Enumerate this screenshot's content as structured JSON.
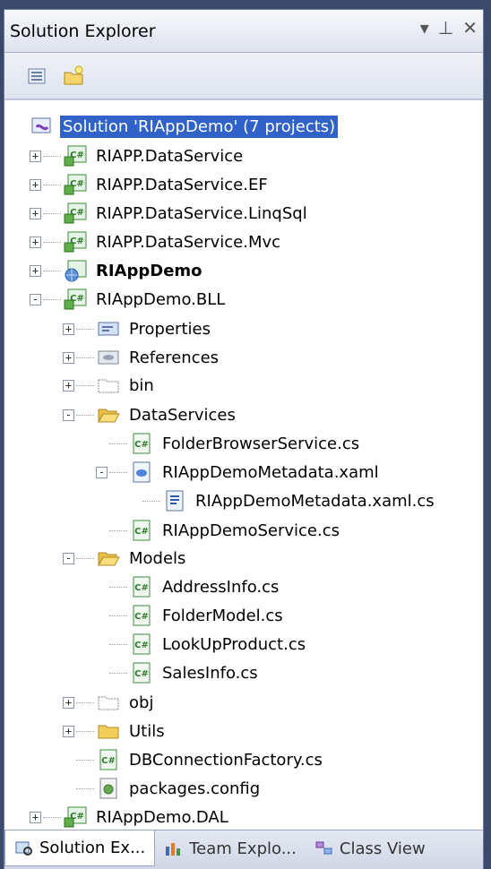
{
  "panel": {
    "title": "Solution Explorer",
    "dropdown_icon": "chevron-down-icon",
    "pin_icon": "pin-icon",
    "close_icon": "close-icon"
  },
  "toolbar": {
    "buttons": [
      {
        "name": "properties-button",
        "icon": "properties-icon"
      },
      {
        "name": "new-folder-button",
        "icon": "new-folder-icon"
      }
    ]
  },
  "tree": {
    "nodes": [
      {
        "label": "Solution 'RIAppDemo' (7 projects)",
        "icon": "solution-icon",
        "selected": true
      },
      {
        "label": "RIAPP.DataService",
        "icon": "csharp-project-icon"
      },
      {
        "label": "RIAPP.DataService.EF",
        "icon": "csharp-project-icon"
      },
      {
        "label": "RIAPP.DataService.LinqSql",
        "icon": "csharp-project-icon"
      },
      {
        "label": "RIAPP.DataService.Mvc",
        "icon": "csharp-project-icon"
      },
      {
        "label": "RIAppDemo",
        "icon": "web-project-icon",
        "bold": true
      },
      {
        "label": "RIAppDemo.BLL",
        "icon": "csharp-project-icon"
      },
      {
        "label": "Properties",
        "icon": "properties-folder-icon"
      },
      {
        "label": "References",
        "icon": "references-icon"
      },
      {
        "label": "bin",
        "icon": "folder-outline-icon"
      },
      {
        "label": "DataServices",
        "icon": "folder-open-icon"
      },
      {
        "label": "FolderBrowserService.cs",
        "icon": "csharp-file-icon"
      },
      {
        "label": "RIAppDemoMetadata.xaml",
        "icon": "xaml-file-icon"
      },
      {
        "label": "RIAppDemoMetadata.xaml.cs",
        "icon": "code-behind-icon"
      },
      {
        "label": "RIAppDemoService.cs",
        "icon": "csharp-file-icon"
      },
      {
        "label": "Models",
        "icon": "folder-open-icon"
      },
      {
        "label": "AddressInfo.cs",
        "icon": "csharp-file-icon"
      },
      {
        "label": "FolderModel.cs",
        "icon": "csharp-file-icon"
      },
      {
        "label": "LookUpProduct.cs",
        "icon": "csharp-file-icon"
      },
      {
        "label": "SalesInfo.cs",
        "icon": "csharp-file-icon"
      },
      {
        "label": "obj",
        "icon": "folder-outline-icon"
      },
      {
        "label": "Utils",
        "icon": "folder-icon"
      },
      {
        "label": "DBConnectionFactory.cs",
        "icon": "csharp-file-icon"
      },
      {
        "label": "packages.config",
        "icon": "config-file-icon"
      },
      {
        "label": "RIAppDemo.DAL",
        "icon": "csharp-project-icon"
      }
    ]
  },
  "tabs": [
    {
      "label": "Solution Ex...",
      "icon": "solution-explorer-icon",
      "active": true
    },
    {
      "label": "Team Explo...",
      "icon": "team-explorer-icon"
    },
    {
      "label": "Class View",
      "icon": "class-view-icon"
    }
  ],
  "colors": {
    "selection": "#3162c8",
    "panel_bg": "#d6dbe9"
  }
}
